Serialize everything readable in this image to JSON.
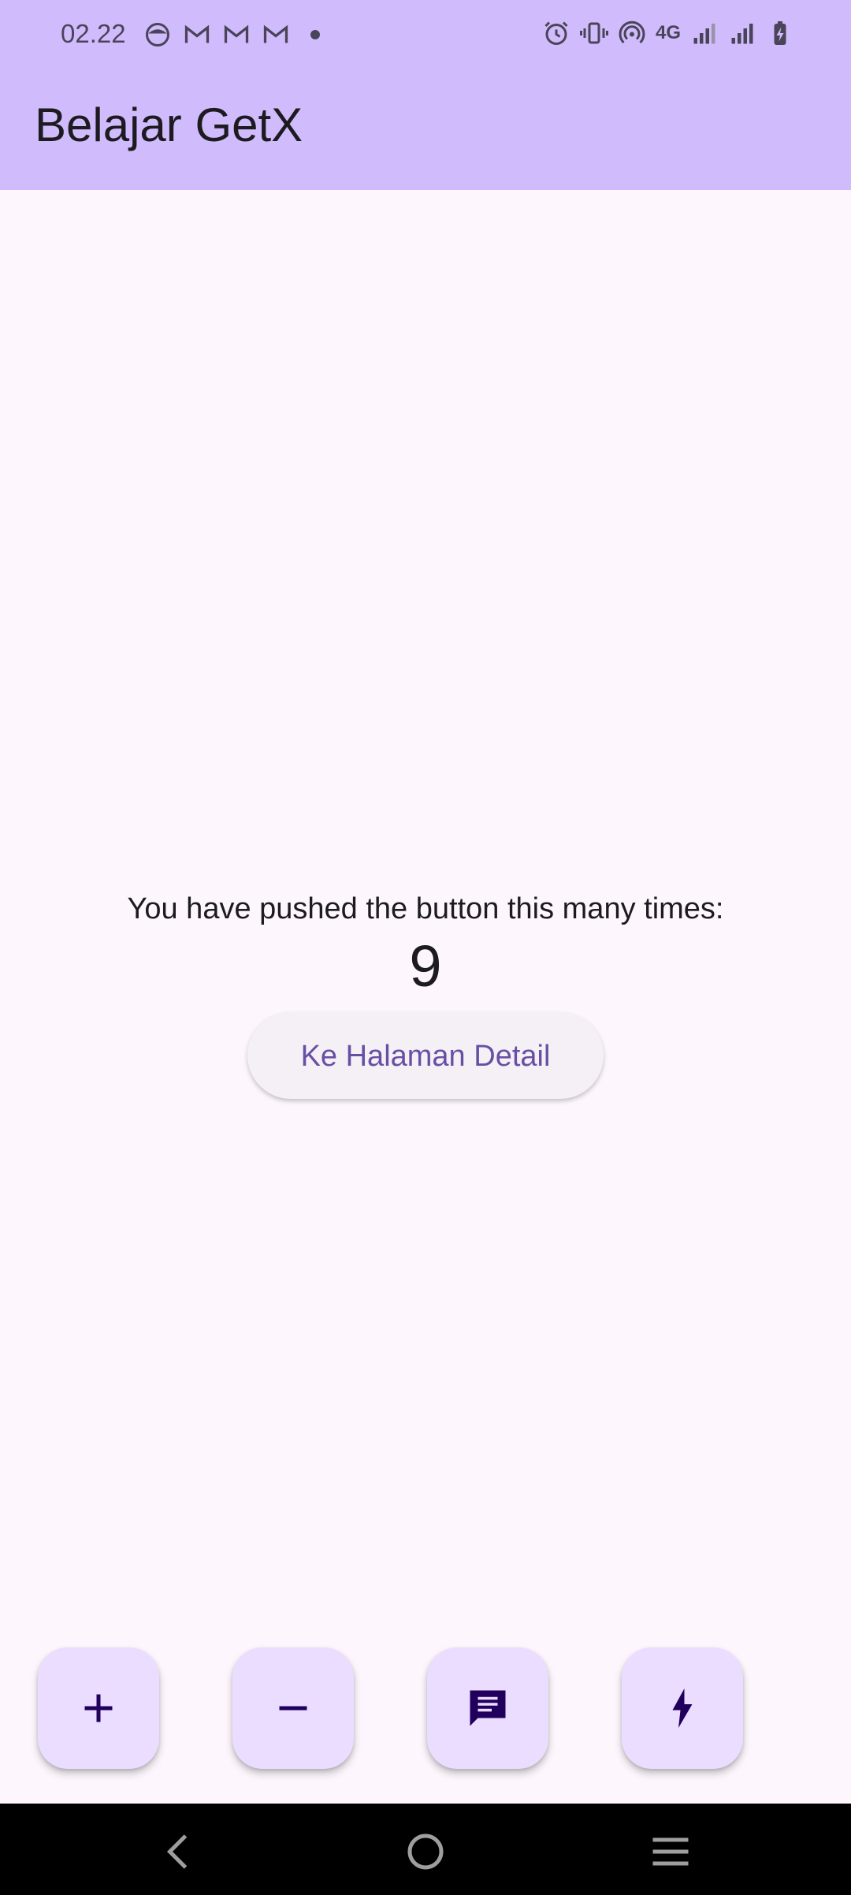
{
  "status_bar": {
    "time": "02.22",
    "network_label": "4G",
    "left_icons": [
      "face-icon",
      "gmail-icon",
      "gmail-icon",
      "gmail-icon",
      "dot-icon"
    ],
    "right_icons": [
      "alarm-icon",
      "vibrate-icon",
      "hotspot-icon",
      "network-4g-icon",
      "signal-icon",
      "signal-icon",
      "battery-charging-icon"
    ]
  },
  "app_bar": {
    "title": "Belajar GetX"
  },
  "main": {
    "message": "You have pushed the button this many times:",
    "counter": "9",
    "detail_button_label": "Ke Halaman Detail"
  },
  "fabs": [
    {
      "icon": "plus-icon"
    },
    {
      "icon": "minus-icon"
    },
    {
      "icon": "message-icon"
    },
    {
      "icon": "flash-icon"
    }
  ],
  "nav_bar": {
    "icons": [
      "back-icon",
      "home-icon",
      "recents-icon"
    ]
  },
  "colors": {
    "app_bar": "#d0bcfd",
    "background": "#fdf7fd",
    "fab": "#eaddff",
    "button_text": "#6750a4",
    "icon": "#21005d"
  }
}
